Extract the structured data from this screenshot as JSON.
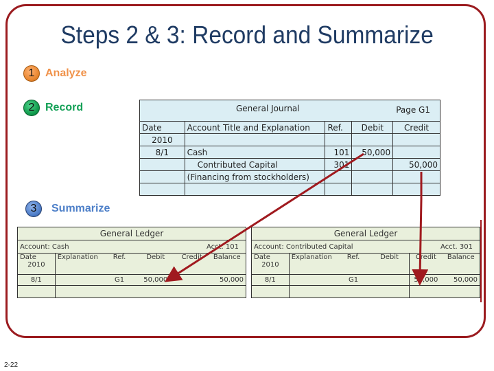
{
  "slide": {
    "title": "Steps 2 & 3:  Record and Summarize",
    "slide_number": "2-22",
    "frame_color": "#9b1b1f",
    "arrow_color": "#a01a1f"
  },
  "steps": [
    {
      "number": "1",
      "label": "Analyze",
      "color": "#f0924a"
    },
    {
      "number": "2",
      "label": "Record",
      "color": "#13a056"
    },
    {
      "number": "3",
      "label": "Summarize",
      "color": "#4d7fc8"
    }
  ],
  "journal": {
    "title": "General Journal",
    "page": "Page G1",
    "headers": [
      "Date",
      "Account Title and Explanation",
      "Ref.",
      "Debit",
      "Credit"
    ],
    "rows": [
      [
        "2010",
        "",
        "",
        "",
        ""
      ],
      [
        "8/1",
        "Cash",
        "101",
        "50,000",
        ""
      ],
      [
        "",
        "Contributed Capital",
        "301",
        "",
        "50,000"
      ],
      [
        "",
        "(Financing from stockholders)",
        "",
        "",
        ""
      ],
      [
        "",
        "",
        "",
        "",
        ""
      ]
    ]
  },
  "ledgers": [
    {
      "title": "General Ledger",
      "account": "Account: Cash",
      "acct_no": "Acct. 101",
      "headers": [
        "Date",
        "Explanation",
        "Ref.",
        "Debit",
        "Credit",
        "Balance"
      ],
      "year": "2010",
      "rows": [
        [
          "8/1",
          "",
          "G1",
          "50,000",
          "",
          "50,000"
        ],
        [
          "",
          "",
          "",
          "",
          "",
          ""
        ]
      ]
    },
    {
      "title": "General Ledger",
      "account": "Account: Contributed Capital",
      "acct_no": "Acct. 301",
      "headers": [
        "Date",
        "Explanation",
        "Ref.",
        "Debit",
        "Credit",
        "Balance"
      ],
      "year": "2010",
      "rows": [
        [
          "8/1",
          "",
          "G1",
          "",
          "50,000",
          "50,000"
        ],
        [
          "",
          "",
          "",
          "",
          "",
          ""
        ]
      ]
    }
  ]
}
